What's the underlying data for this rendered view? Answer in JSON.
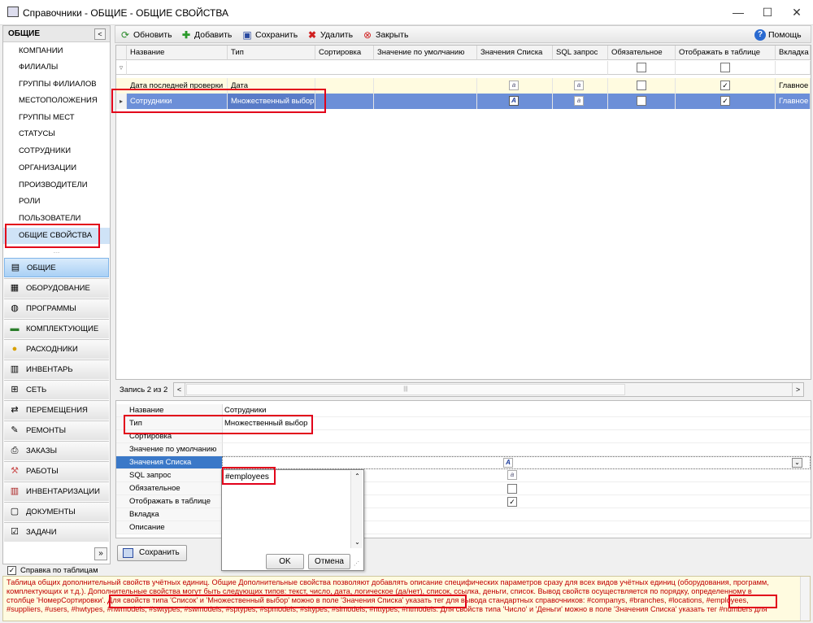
{
  "window": {
    "title": "Справочники - ОБЩИЕ - ОБЩИЕ СВОЙСТВА"
  },
  "sidebar": {
    "header": "ОБЩИЕ",
    "items": [
      "КОМПАНИИ",
      "ФИЛИАЛЫ",
      "ГРУППЫ ФИЛИАЛОВ",
      "МЕСТОПОЛОЖЕНИЯ",
      "ГРУППЫ МЕСТ",
      "СТАТУСЫ",
      "СОТРУДНИКИ",
      "ОРГАНИЗАЦИИ",
      "ПРОИЗВОДИТЕЛИ",
      "РОЛИ",
      "ПОЛЬЗОВАТЕЛИ",
      "ОБЩИЕ СВОЙСТВА"
    ],
    "groups": [
      "ОБЩИЕ",
      "ОБОРУДОВАНИЕ",
      "ПРОГРАММЫ",
      "КОМПЛЕКТУЮЩИЕ",
      "РАСХОДНИКИ",
      "ИНВЕНТАРЬ",
      "СЕТЬ",
      "ПЕРЕМЕЩЕНИЯ",
      "РЕМОНТЫ",
      "ЗАКАЗЫ",
      "РАБОТЫ",
      "ИНВЕНТАРИЗАЦИИ",
      "ДОКУМЕНТЫ",
      "ЗАДАЧИ"
    ]
  },
  "toolbar": {
    "refresh": "Обновить",
    "add": "Добавить",
    "save": "Сохранить",
    "delete": "Удалить",
    "close": "Закрыть",
    "help": "Помощь"
  },
  "grid": {
    "columns": [
      "Название",
      "Тип",
      "Сортировка",
      "Значение по умолчанию",
      "Значения Списка",
      "SQL запрос",
      "Обязательное",
      "Отображать в таблице",
      "Вкладка"
    ],
    "rows": [
      {
        "name": "Дата последней проверки",
        "type": "Дата",
        "required": false,
        "show": true,
        "tab": "Главное"
      },
      {
        "name": "Сотрудники",
        "type": "Множественный выбор",
        "required": false,
        "show": true,
        "tab": "Главное"
      }
    ],
    "record_status": "Запись 2 из 2"
  },
  "props": {
    "labels": [
      "Название",
      "Тип",
      "Сортировка",
      "Значение по умолчанию",
      "Значения Списка",
      "SQL запрос",
      "Обязательное",
      "Отображать в таблице",
      "Вкладка",
      "Описание"
    ],
    "name_value": "Сотрудники",
    "type_value": "Множественный выбор",
    "save": "Сохранить"
  },
  "popup": {
    "text": "#employees",
    "ok": "OK",
    "cancel": "Отмена"
  },
  "help": {
    "checkbox": "Справка по таблицам",
    "line1": "Таблица общих дополнительный свойств учётных единиц. Общие Дополнительные свойства позволяют добавлять описание специфических параметров сразу для всех видов учётных единиц (оборудования, программ,",
    "line2": "комплектующих и т.д.). Дополнительные свойства могут быть следующих типов: текст, число, дата, логическое (да/нет), список, ссылка, деньги, список. Вывод свойств осуществляется по порядку, определенному в",
    "line3": "столбце 'НомерСортировки'. Для свойств типа 'Список' и 'Множественный выбор' можно в поле 'Значения Списка' указать тег для вывода стандартных справочников: #companys, #branches, #locations, #employees,",
    "line4": "#suppliers, #users, #hwtypes, #hwmodels, #swtypes, #swmodels, #sptypes, #spmodels, #sitypes, #simodels, #nttypes, #ntmodels. Для свойств типа 'Число' и 'Деньги' можно в поле 'Значения Списка' указать тег #numbers для"
  },
  "colors": {
    "accent": "#3a78c8",
    "highlight": "#e2001a",
    "help_text": "#c00000"
  }
}
